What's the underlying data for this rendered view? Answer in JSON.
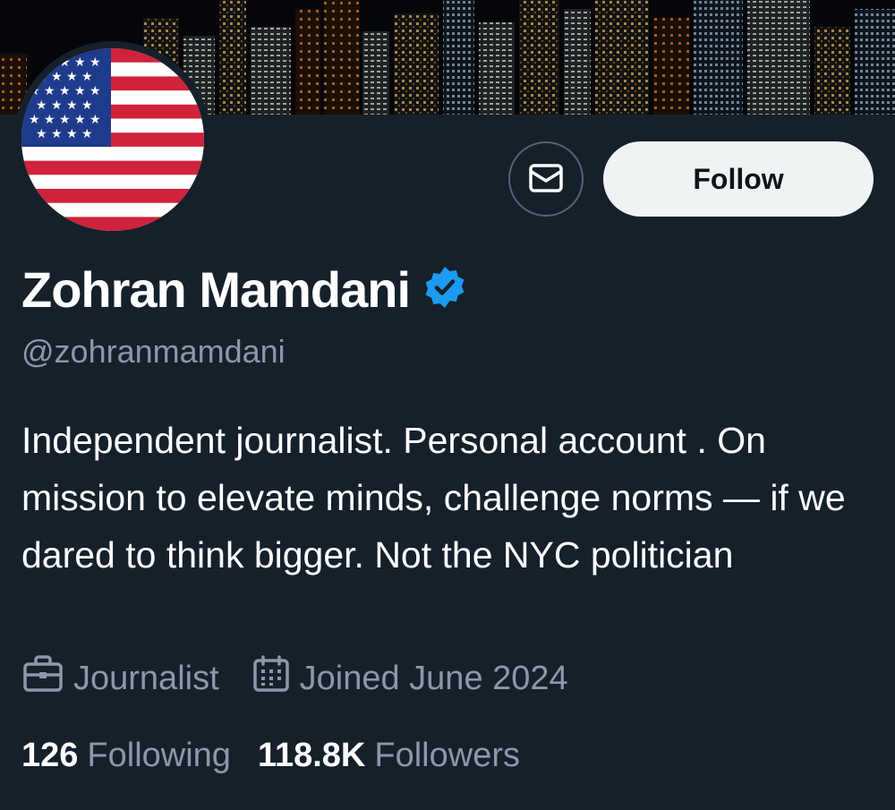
{
  "profile": {
    "display_name": "Zohran Mamdani",
    "handle": "@zohranmamdani",
    "verified": true,
    "bio": "Independent journalist. Personal account . On mission to elevate minds, challenge norms — if we dared to think bigger. Not the NYC politician",
    "category": "Journalist",
    "joined": "Joined June 2024"
  },
  "stats": {
    "following_count": "126",
    "following_label": "Following",
    "followers_count": "118.8K",
    "followers_label": "Followers"
  },
  "actions": {
    "follow_label": "Follow",
    "message_icon": "envelope-icon"
  },
  "icons": {
    "verified": "verified-badge-icon",
    "category": "briefcase-icon",
    "joined": "calendar-icon"
  },
  "colors": {
    "background": "#15202b",
    "secondary_text": "#8b98a5",
    "verified_blue": "#1d9bf0",
    "follow_button_bg": "#eff3f4"
  }
}
